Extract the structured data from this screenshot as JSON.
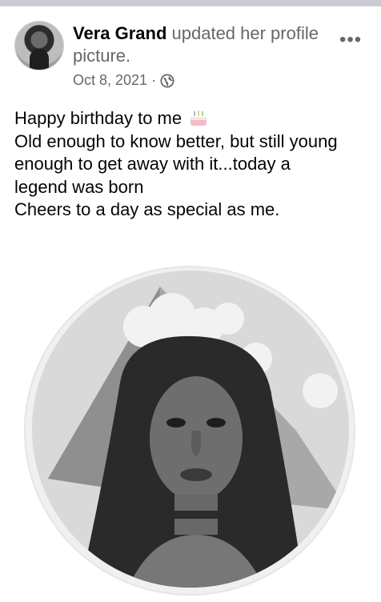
{
  "post": {
    "author_name": "Vera Grand",
    "action_text": "updated her profile picture.",
    "date": "Oct 8, 2021",
    "separator": "·",
    "privacy_icon": "globe-icon",
    "more_icon": "more-options-icon",
    "more_label": "•••"
  },
  "caption": {
    "lines": [
      "Happy birthday to me",
      "Old enough to know better, but still young",
      "enough to get away with it...today a",
      "legend was born",
      "Cheers to a day as special as me."
    ],
    "emoji": "birthday-cake-icon"
  },
  "colors": {
    "name": "#050505",
    "secondary_text": "#65676b",
    "top_bar": "#c9ccd1"
  }
}
